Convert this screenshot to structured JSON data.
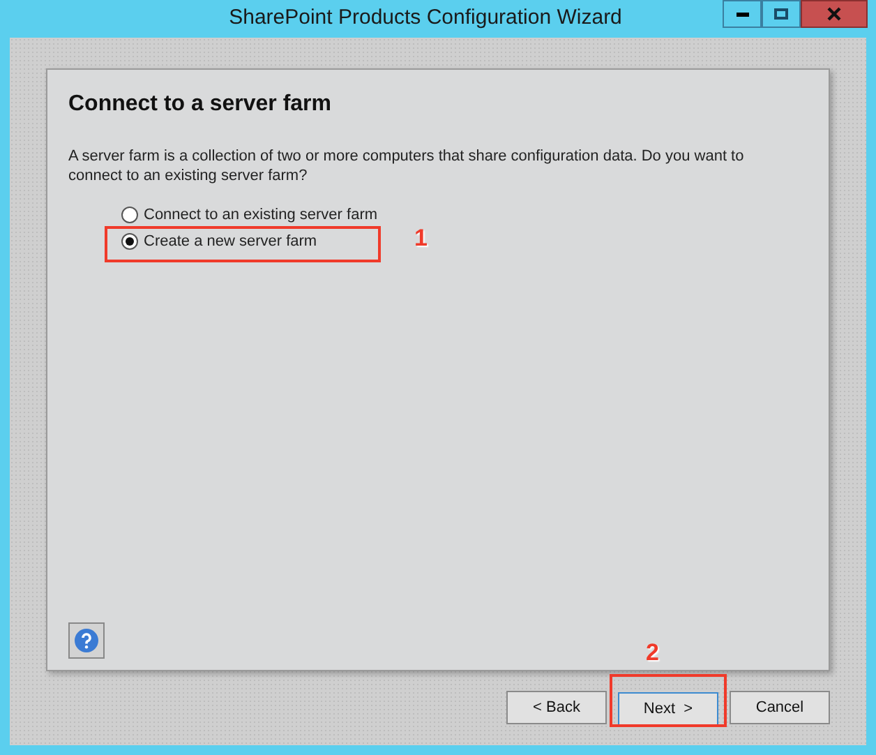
{
  "window": {
    "title": "SharePoint Products Configuration Wizard"
  },
  "page": {
    "heading": "Connect to a server farm",
    "description": "A server farm is a collection of two or more computers that share configuration data.  Do you want to connect to an existing server farm?"
  },
  "options": [
    {
      "label": "Connect to an existing server farm",
      "selected": false
    },
    {
      "label": "Create a new server farm",
      "selected": true,
      "callout": "1"
    }
  ],
  "buttons": [
    {
      "label": "< Back",
      "focused": false
    },
    {
      "label": "Next  >",
      "focused": true,
      "callout": "2"
    },
    {
      "label": "Cancel",
      "focused": false
    }
  ]
}
